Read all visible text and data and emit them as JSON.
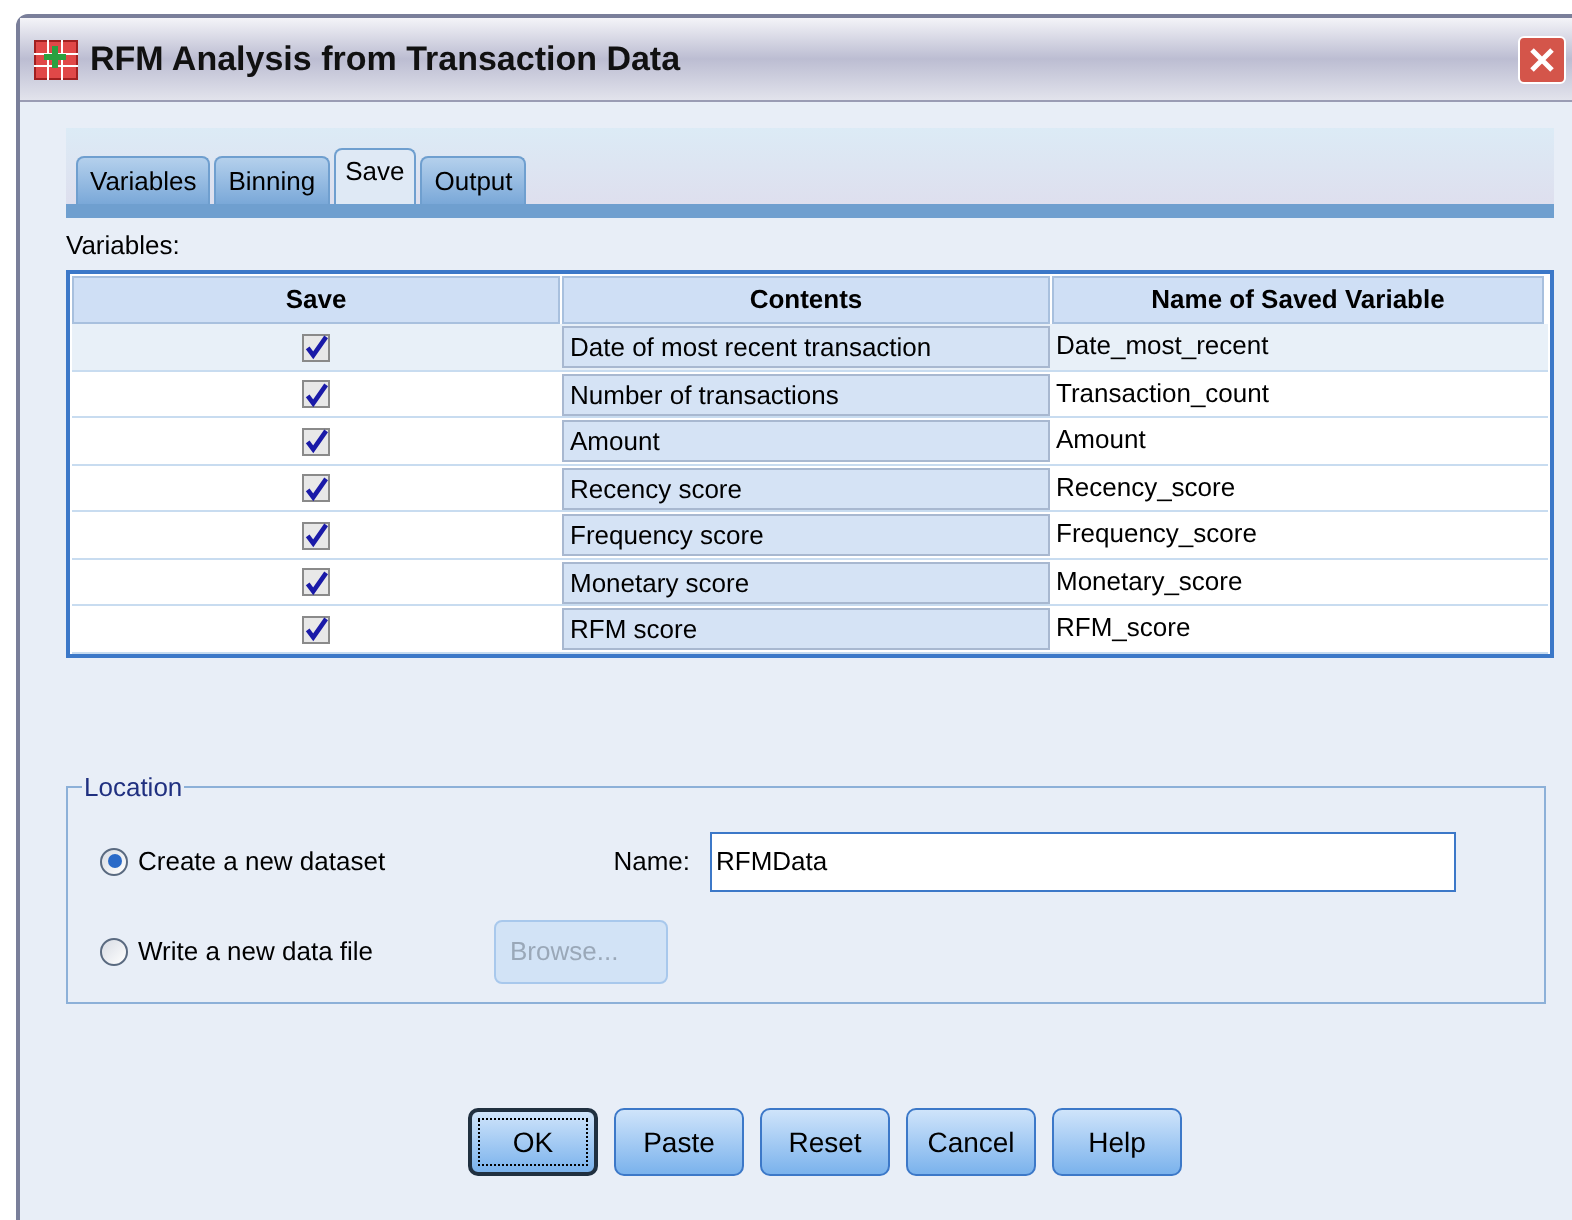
{
  "window": {
    "title": "RFM Analysis from Transaction Data"
  },
  "tabs": [
    {
      "label": "Variables",
      "selected": false
    },
    {
      "label": "Binning",
      "selected": false
    },
    {
      "label": "Save",
      "selected": true
    },
    {
      "label": "Output",
      "selected": false
    }
  ],
  "variables_label": "Variables:",
  "table": {
    "columns": [
      "Save",
      "Contents",
      "Name of Saved Variable"
    ],
    "rows": [
      {
        "checked": true,
        "contents": "Date of most recent transaction",
        "name": "Date_most_recent"
      },
      {
        "checked": true,
        "contents": "Number of transactions",
        "name": "Transaction_count"
      },
      {
        "checked": true,
        "contents": "Amount",
        "name": "Amount"
      },
      {
        "checked": true,
        "contents": "Recency score",
        "name": "Recency_score"
      },
      {
        "checked": true,
        "contents": "Frequency score",
        "name": "Frequency_score"
      },
      {
        "checked": true,
        "contents": "Monetary score",
        "name": "Monetary_score"
      },
      {
        "checked": true,
        "contents": "RFM score",
        "name": "RFM_score"
      }
    ]
  },
  "location": {
    "title": "Location",
    "options": [
      {
        "label": "Create a new dataset",
        "selected": true
      },
      {
        "label": "Write a new data file",
        "selected": false
      }
    ],
    "name_label": "Name:",
    "name_value": "RFMData",
    "browse": {
      "label": "Browse...",
      "disabled": true
    }
  },
  "buttons": [
    {
      "label": "OK",
      "default": true
    },
    {
      "label": "Paste",
      "default": false
    },
    {
      "label": "Reset",
      "default": false
    },
    {
      "label": "Cancel",
      "default": false
    },
    {
      "label": "Help",
      "default": false
    }
  ]
}
